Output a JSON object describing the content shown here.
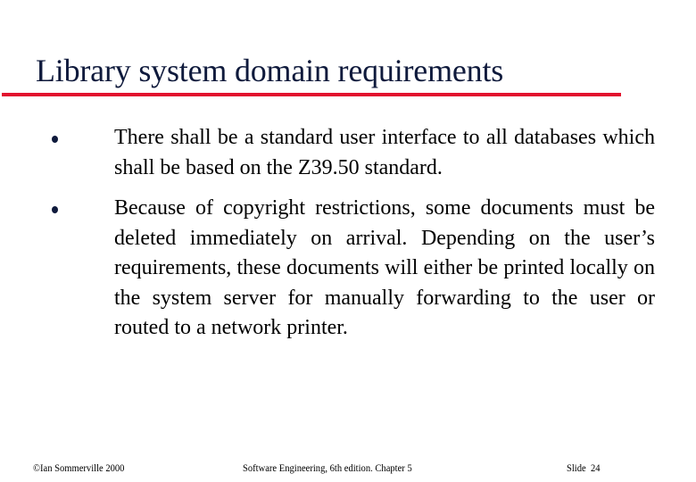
{
  "slide": {
    "title": "Library system domain requirements",
    "accent_color": "#e2112e",
    "title_color": "#0f1a3c",
    "bullets": [
      {
        "icon": "bullet-dot-icon",
        "text": "There shall be a standard user interface to all databases which shall be based on the Z39.50 standard."
      },
      {
        "icon": "bullet-dot-icon",
        "text": "Because of copyright restrictions, some documents must be deleted immediately on arrival. Depending on the user’s requirements, these documents will either be printed locally on the system server for manually forwarding to the user or routed to a network printer."
      }
    ],
    "footer": {
      "left": "©Ian Sommerville 2000",
      "center": "Software Engineering, 6th edition. Chapter 5",
      "right": "Slide  24"
    }
  }
}
